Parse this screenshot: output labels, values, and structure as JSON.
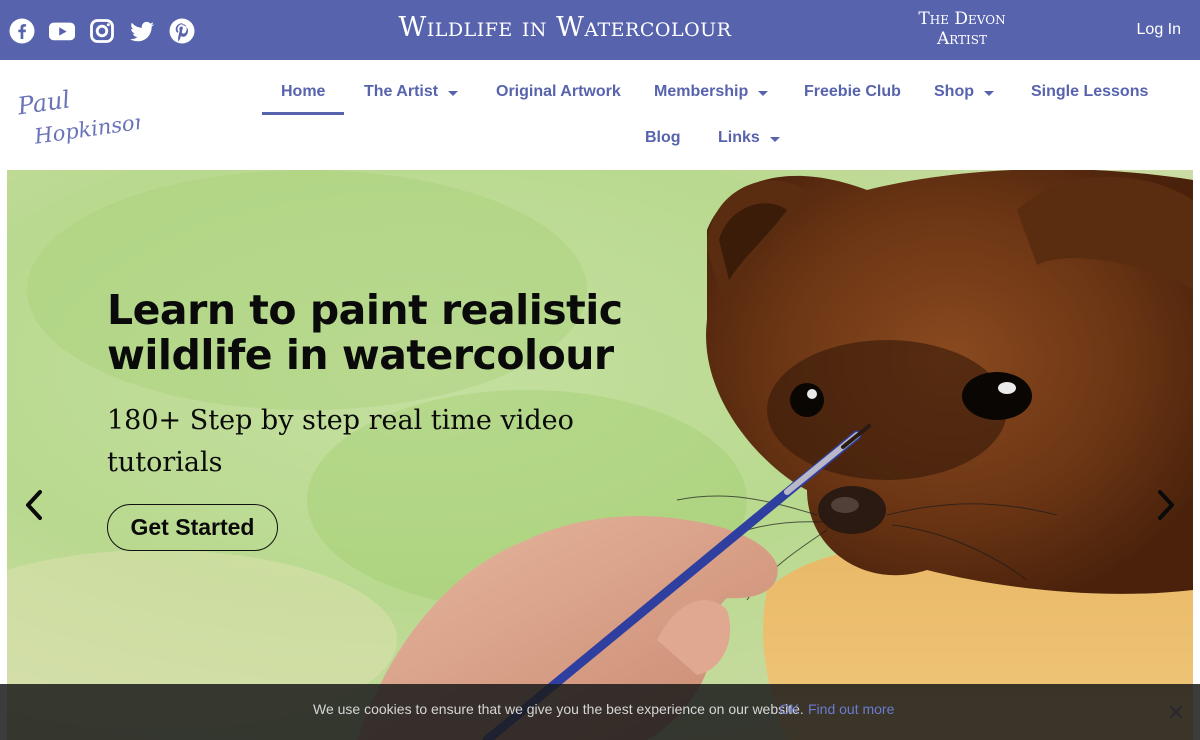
{
  "topbar": {
    "social": [
      {
        "icon": "facebook-icon"
      },
      {
        "icon": "youtube-icon"
      },
      {
        "icon": "instagram-icon"
      },
      {
        "icon": "twitter-icon"
      },
      {
        "icon": "pinterest-icon"
      }
    ],
    "site_title": "Wildlife in Watercolour",
    "tagline_line1": "The Devon",
    "tagline_line2": "Artist",
    "login_label": "Log In",
    "background_color": "#5763ad"
  },
  "header": {
    "logo_line1": "Paul",
    "logo_line2": "Hopkinson",
    "nav": [
      {
        "label": "Home",
        "active": true
      },
      {
        "label": "The Artist",
        "dropdown": true
      },
      {
        "label": "Original Artwork"
      },
      {
        "label": "Membership",
        "dropdown": true
      },
      {
        "label": "Freebie Club"
      },
      {
        "label": "Shop",
        "dropdown": true
      },
      {
        "label": "Single Lessons"
      },
      {
        "label": "Blog"
      },
      {
        "label": "Links",
        "dropdown": true
      }
    ],
    "accent_color": "#5763ad"
  },
  "hero": {
    "title_line1": "Learn to paint realistic",
    "title_line2": "wildlife in watercolour",
    "subtitle_line1": "180+ Step by step real time video",
    "subtitle_line2": "tutorials",
    "cta_label": "Get Started",
    "prev_icon": "chevron-left-icon",
    "next_icon": "chevron-right-icon"
  },
  "cookie": {
    "text": "We use cookies to ensure that we give you the best experience on our website.",
    "ok_label": "OK",
    "more_label": "Find out more",
    "close_icon": "close-icon"
  }
}
